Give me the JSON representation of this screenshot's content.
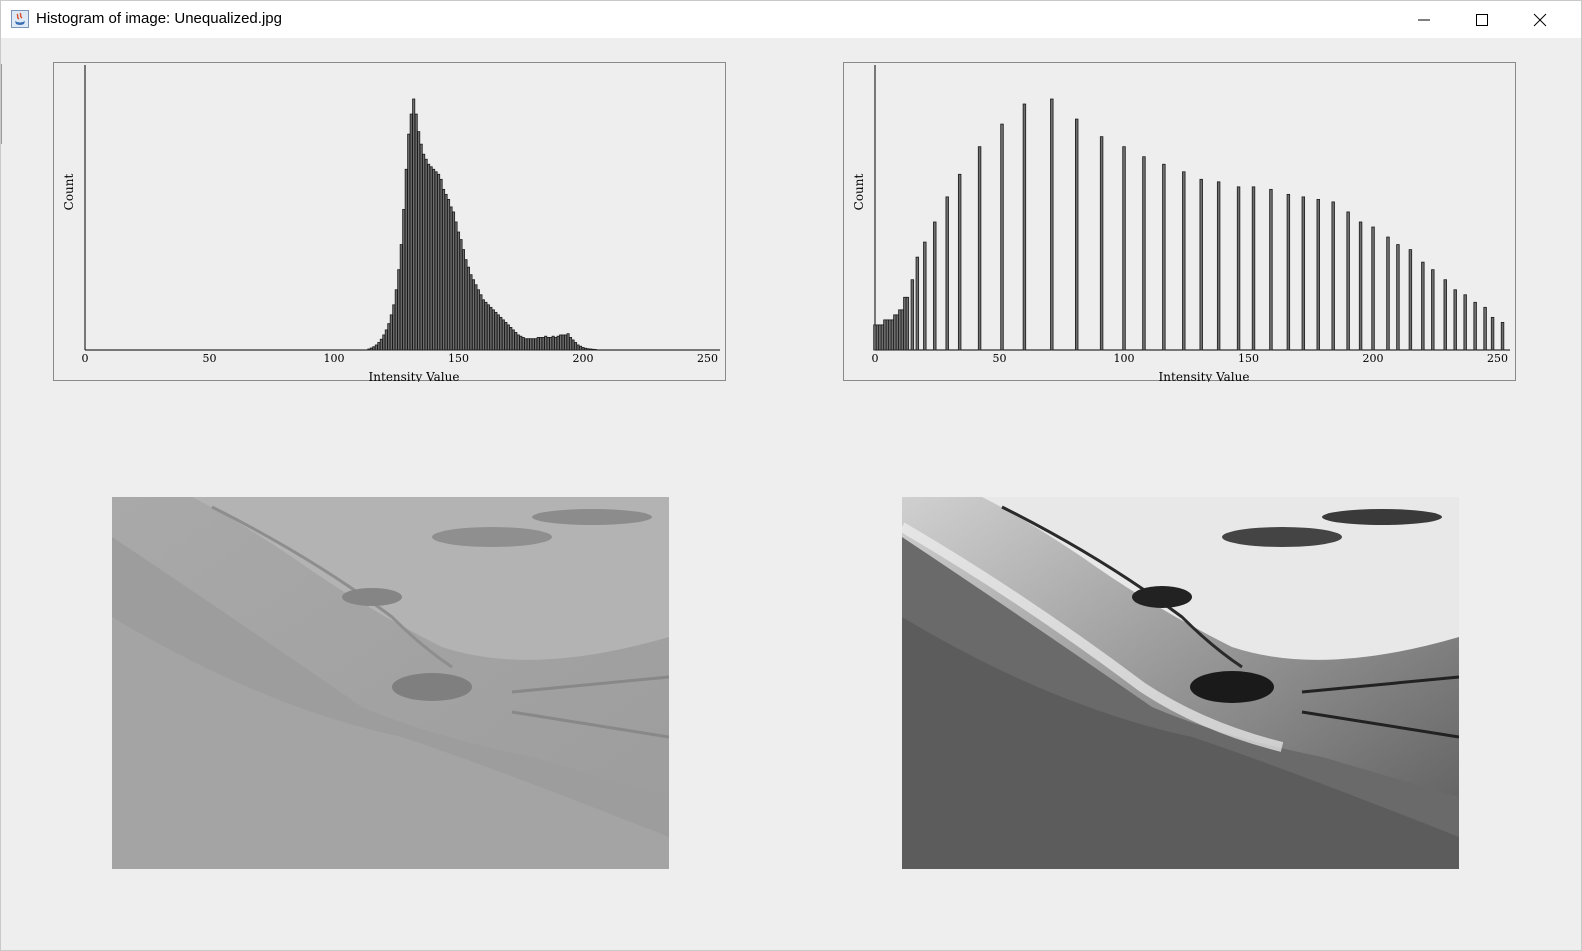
{
  "window": {
    "title": "Histogram of image: Unequalized.jpg",
    "controls": [
      "minimize-icon",
      "maximize-icon",
      "close-icon"
    ]
  },
  "colors": {
    "background": "#eeeeee",
    "bar_fill": "#6e6e6e",
    "bar_outline": "#1a1a1a",
    "axis": "#000000"
  },
  "chart_data": [
    {
      "type": "bar",
      "name": "original-histogram",
      "title": "",
      "xlabel": "Intensity Value",
      "ylabel": "Count",
      "xlim": [
        0,
        255
      ],
      "ylim": [
        0,
        1
      ],
      "xticks": [
        0,
        50,
        100,
        150,
        200,
        250
      ],
      "bins": [
        114,
        115,
        116,
        117,
        118,
        119,
        120,
        121,
        122,
        123,
        124,
        125,
        126,
        127,
        128,
        129,
        130,
        131,
        132,
        133,
        134,
        135,
        136,
        137,
        138,
        139,
        140,
        141,
        142,
        143,
        144,
        145,
        146,
        147,
        148,
        149,
        150,
        151,
        152,
        153,
        154,
        155,
        156,
        157,
        158,
        159,
        160,
        161,
        162,
        163,
        164,
        165,
        166,
        167,
        168,
        169,
        170,
        171,
        172,
        173,
        174,
        175,
        176,
        177,
        178,
        179,
        180,
        181,
        182,
        183,
        184,
        185,
        186,
        187,
        188,
        189,
        190,
        191,
        192,
        193,
        194,
        195,
        196,
        197,
        198,
        199,
        200,
        201,
        202,
        203,
        204,
        205
      ],
      "values": [
        0.004,
        0.008,
        0.013,
        0.02,
        0.03,
        0.043,
        0.06,
        0.08,
        0.105,
        0.14,
        0.18,
        0.24,
        0.32,
        0.42,
        0.56,
        0.72,
        0.86,
        0.94,
        1.0,
        0.94,
        0.87,
        0.82,
        0.78,
        0.76,
        0.74,
        0.73,
        0.72,
        0.71,
        0.7,
        0.68,
        0.64,
        0.62,
        0.6,
        0.57,
        0.55,
        0.51,
        0.47,
        0.44,
        0.4,
        0.36,
        0.33,
        0.3,
        0.28,
        0.26,
        0.24,
        0.22,
        0.2,
        0.19,
        0.18,
        0.17,
        0.16,
        0.15,
        0.14,
        0.13,
        0.12,
        0.11,
        0.1,
        0.09,
        0.08,
        0.07,
        0.06,
        0.055,
        0.05,
        0.045,
        0.045,
        0.045,
        0.045,
        0.045,
        0.05,
        0.05,
        0.05,
        0.055,
        0.05,
        0.05,
        0.055,
        0.05,
        0.055,
        0.06,
        0.06,
        0.06,
        0.065,
        0.05,
        0.04,
        0.03,
        0.02,
        0.015,
        0.01,
        0.007,
        0.005,
        0.004,
        0.003,
        0.002
      ]
    },
    {
      "type": "bar",
      "name": "equalized-histogram",
      "title": "",
      "xlabel": "Intensity Value",
      "ylabel": "Count",
      "xlim": [
        0,
        255
      ],
      "ylim": [
        0,
        1
      ],
      "xticks": [
        0,
        50,
        100,
        150,
        200,
        250
      ],
      "bins": [
        0,
        1,
        2,
        3,
        4,
        5,
        6,
        7,
        8,
        9,
        10,
        11,
        12,
        13,
        15,
        17,
        20,
        24,
        29,
        34,
        42,
        51,
        60,
        71,
        81,
        91,
        100,
        108,
        116,
        124,
        131,
        138,
        146,
        152,
        159,
        166,
        172,
        178,
        184,
        190,
        195,
        200,
        206,
        210,
        215,
        220,
        224,
        229,
        233,
        237,
        241,
        245,
        248,
        252
      ],
      "values": [
        0.1,
        0.1,
        0.1,
        0.1,
        0.12,
        0.12,
        0.12,
        0.12,
        0.14,
        0.14,
        0.16,
        0.16,
        0.21,
        0.21,
        0.28,
        0.37,
        0.43,
        0.51,
        0.61,
        0.7,
        0.81,
        0.9,
        0.98,
        1.0,
        0.92,
        0.85,
        0.81,
        0.77,
        0.74,
        0.71,
        0.68,
        0.67,
        0.65,
        0.65,
        0.64,
        0.62,
        0.61,
        0.6,
        0.59,
        0.55,
        0.51,
        0.49,
        0.45,
        0.42,
        0.4,
        0.35,
        0.32,
        0.28,
        0.24,
        0.22,
        0.19,
        0.17,
        0.13,
        0.11
      ],
      "values_full": [
        0.12,
        0.1,
        0.12,
        0.09,
        0.12,
        0.1,
        0.14,
        0.11,
        0.16,
        0.12,
        0.21,
        0.14,
        0.28,
        0.16,
        0.36,
        0.19,
        0.43,
        0.23,
        0.51,
        0.27,
        0.61,
        0.32,
        0.7,
        0.37,
        0.81,
        0.42,
        0.9,
        0.48,
        0.98,
        0.54,
        1.0,
        0.6,
        0.92,
        0.65,
        0.85,
        0.7,
        0.81,
        0.74,
        0.77,
        0.75,
        0.74,
        0.72,
        0.71,
        0.7,
        0.68,
        0.68
      ]
    }
  ],
  "images": [
    {
      "label": "original-image",
      "tone": "low-contrast"
    },
    {
      "label": "equalized-image",
      "tone": "high-contrast"
    }
  ]
}
